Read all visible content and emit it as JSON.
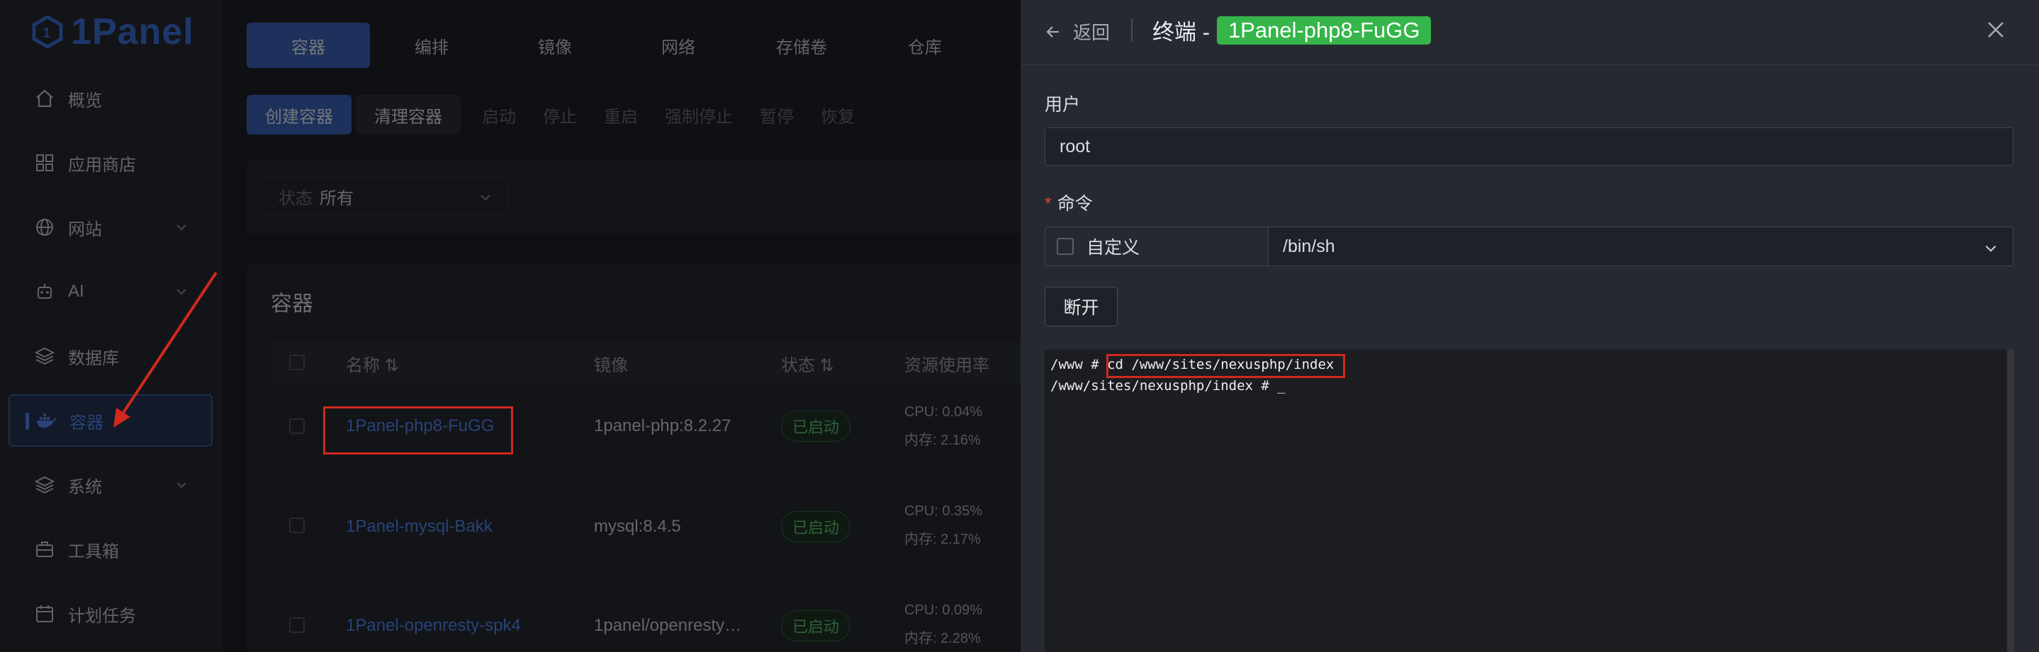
{
  "sidebar": {
    "logo": "1Panel",
    "items": [
      {
        "label": "概览",
        "icon": "home-icon"
      },
      {
        "label": "应用商店",
        "icon": "grid-icon"
      },
      {
        "label": "网站",
        "icon": "globe-icon",
        "expandable": true
      },
      {
        "label": "AI",
        "icon": "robot-icon",
        "expandable": true
      },
      {
        "label": "数据库",
        "icon": "layers-icon"
      },
      {
        "label": "容器",
        "icon": "docker-icon",
        "active": true
      },
      {
        "label": "系统",
        "icon": "layers-icon",
        "expandable": true
      },
      {
        "label": "工具箱",
        "icon": "toolbox-icon"
      },
      {
        "label": "计划任务",
        "icon": "calendar-icon"
      }
    ]
  },
  "tabs": [
    "容器",
    "编排",
    "镜像",
    "网络",
    "存储卷",
    "仓库"
  ],
  "toolbar": {
    "create": "创建容器",
    "clean": "清理容器",
    "actions": [
      "启动",
      "停止",
      "重启",
      "强制停止",
      "暂停",
      "恢复"
    ]
  },
  "filter": {
    "prefix": "状态",
    "value": "所有"
  },
  "panel": {
    "title": "容器",
    "columns": {
      "name": "名称",
      "image": "镜像",
      "status": "状态",
      "usage": "资源使用率"
    },
    "rows": [
      {
        "name": "1Panel-php8-FuGG",
        "image": "1panel-php:8.2.27",
        "status": "已启动",
        "cpu": "CPU: 0.04%",
        "mem": "内存: 2.16%"
      },
      {
        "name": "1Panel-mysql-Bakk",
        "image": "mysql:8.4.5",
        "status": "已启动",
        "cpu": "CPU: 0.35%",
        "mem": "内存: 2.17%"
      },
      {
        "name": "1Panel-openresty-spk4",
        "image": "1panel/openresty…",
        "status": "已启动",
        "cpu": "CPU: 0.09%",
        "mem": "内存: 2.28%"
      }
    ]
  },
  "drawer": {
    "back": "返回",
    "title": "终端 -",
    "container": "1Panel-php8-FuGG",
    "user_label": "用户",
    "user_value": "root",
    "command_label": "命令",
    "custom_label": "自定义",
    "command_value": "/bin/sh",
    "disconnect": "断开",
    "terminal": {
      "line1_prompt": "/www # ",
      "line1_cmd": "cd /www/sites/nexusphp/index",
      "line2": "/www/sites/nexusphp/index # _"
    }
  },
  "colors": {
    "accent": "#3a63b8",
    "link": "#4f86ee",
    "success": "#36b54a",
    "annotation": "#d0291e"
  }
}
